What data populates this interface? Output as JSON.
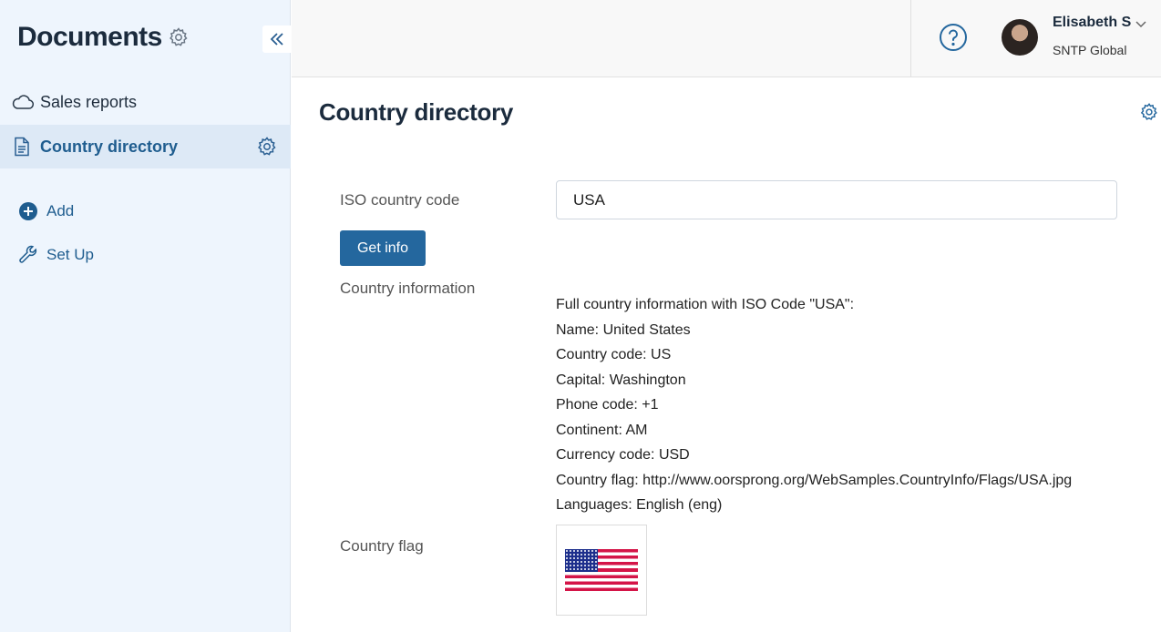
{
  "sidebar": {
    "app_title": "Documents",
    "items": [
      {
        "label": "Sales reports",
        "icon": "cloud-icon"
      },
      {
        "label": "Country directory",
        "icon": "document-icon",
        "active": true
      }
    ],
    "actions": [
      {
        "label": "Add",
        "icon": "plus-circle-icon"
      },
      {
        "label": "Set Up",
        "icon": "wrench-icon"
      }
    ]
  },
  "header": {
    "user_name": "Elisabeth S",
    "company": "SNTP Global"
  },
  "main": {
    "title": "Country directory",
    "iso_label": "ISO country code",
    "iso_value": "USA",
    "get_info_label": "Get info",
    "info_label": "Country information",
    "info_lines": [
      "Full country information with ISO Code \"USA\":",
      "Name: United States",
      "Country code: US",
      "Capital: Washington",
      "Phone code: +1",
      "Continent: AM",
      "Currency code: USD",
      "Country flag: http://www.oorsprong.org/WebSamples.CountryInfo/Flags/USA.jpg",
      "Languages: English (eng)"
    ],
    "flag_label": "Country flag"
  },
  "colors": {
    "sidebar_bg": "#eef5fd",
    "active_item_bg": "#dde9f6",
    "accent": "#24679e",
    "link": "#1f5d8f"
  }
}
